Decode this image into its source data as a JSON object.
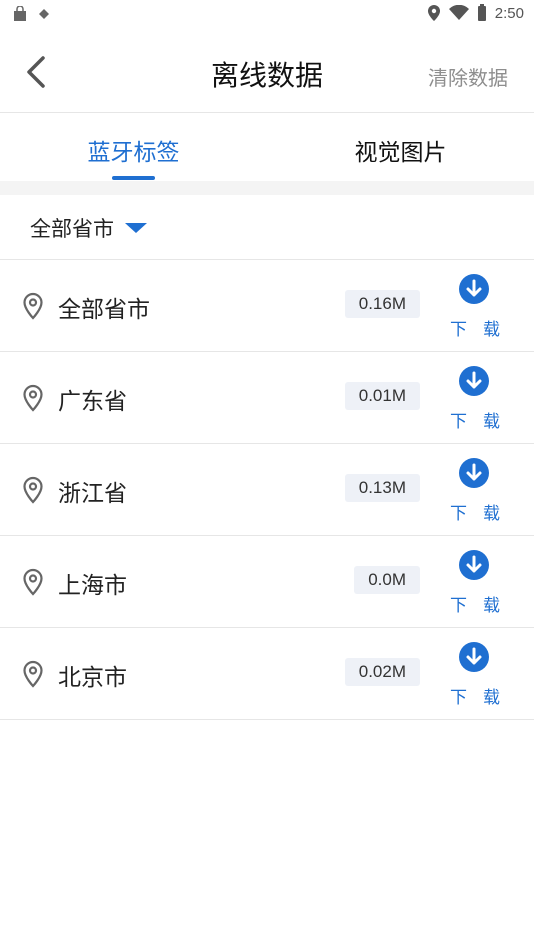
{
  "status_bar": {
    "time": "2:50"
  },
  "app_bar": {
    "title": "离线数据",
    "clear_label": "清除数据"
  },
  "tabs": [
    {
      "label": "蓝牙标签",
      "active": true
    },
    {
      "label": "视觉图片",
      "active": false
    }
  ],
  "filter": {
    "label": "全部省市"
  },
  "items": [
    {
      "name": "全部省市",
      "size": "0.16M",
      "action": "下载"
    },
    {
      "name": "广东省",
      "size": "0.01M",
      "action": "下载"
    },
    {
      "name": "浙江省",
      "size": "0.13M",
      "action": "下载"
    },
    {
      "name": "上海市",
      "size": "0.0M",
      "action": "下载"
    },
    {
      "name": "北京市",
      "size": "0.02M",
      "action": "下载"
    }
  ],
  "colors": {
    "accent": "#1f6fd1",
    "divider": "#e6e6e6",
    "badge_bg": "#eef1f7"
  }
}
